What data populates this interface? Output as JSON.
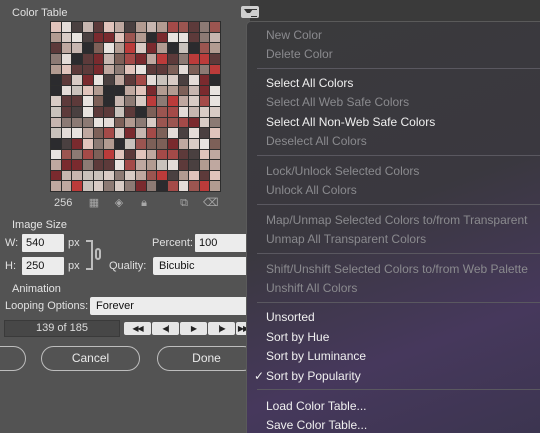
{
  "panel": {
    "title": "Color Table",
    "color_count": "256",
    "image_size": {
      "section_title": "Image Size",
      "width_label": "W:",
      "width_value": "540",
      "width_unit": "px",
      "height_label": "H:",
      "height_value": "250",
      "height_unit": "px",
      "percent_label": "Percent:",
      "percent_value": "100",
      "quality_label": "Quality:",
      "quality_value": "Bicubic"
    },
    "animation": {
      "section_title": "Animation",
      "looping_label": "Looping Options:",
      "looping_value": "Forever",
      "frame_status": "139 of 185",
      "controls": [
        "◀◀",
        "◀|",
        "▶",
        "|▶",
        "▶▶"
      ]
    },
    "buttons": {
      "cancel": "Cancel",
      "done": "Done"
    },
    "swatch_colors": [
      "#7a2a2e",
      "#c7b6b0",
      "#a44a48",
      "#e8e3df",
      "#5d3a3a",
      "#b29b91",
      "#2b2b2e",
      "#8c7a74",
      "#e4dcd8",
      "#9b5550",
      "#c9c2bc",
      "#4a4040",
      "#d8cbc5",
      "#7d6058",
      "#bfa8a0",
      "#e1c4bc",
      "#bb3b3a"
    ],
    "tool_icons": [
      "grid-icon",
      "cube-icon",
      "lock-icon",
      "new-swatch-icon",
      "trash-icon"
    ]
  },
  "menu": {
    "items": [
      {
        "label": "New Color",
        "enabled": false,
        "checked": false
      },
      {
        "label": "Delete Color",
        "enabled": false,
        "checked": false
      },
      {
        "label": "Select All Colors",
        "enabled": true,
        "checked": false
      },
      {
        "label": "Select All Web Safe Colors",
        "enabled": false,
        "checked": false
      },
      {
        "label": "Select All Non-Web Safe Colors",
        "enabled": true,
        "checked": false
      },
      {
        "label": "Deselect All Colors",
        "enabled": false,
        "checked": false
      },
      {
        "label": "Lock/Unlock Selected Colors",
        "enabled": false,
        "checked": false
      },
      {
        "label": "Unlock All Colors",
        "enabled": false,
        "checked": false
      },
      {
        "label": "Map/Unmap Selected Colors to/from Transparent",
        "enabled": false,
        "checked": false
      },
      {
        "label": "Unmap All Transparent Colors",
        "enabled": false,
        "checked": false
      },
      {
        "label": "Shift/Unshift Selected Colors to/from Web Palette",
        "enabled": false,
        "checked": false
      },
      {
        "label": "Unshift All Colors",
        "enabled": false,
        "checked": false
      },
      {
        "label": "Unsorted",
        "enabled": true,
        "checked": false
      },
      {
        "label": "Sort by Hue",
        "enabled": true,
        "checked": false
      },
      {
        "label": "Sort by Luminance",
        "enabled": true,
        "checked": false
      },
      {
        "label": "Sort by Popularity",
        "enabled": true,
        "checked": true
      },
      {
        "label": "Load Color Table...",
        "enabled": true,
        "checked": false
      },
      {
        "label": "Save Color Table...",
        "enabled": true,
        "checked": false
      }
    ],
    "check_mark": "✓"
  }
}
